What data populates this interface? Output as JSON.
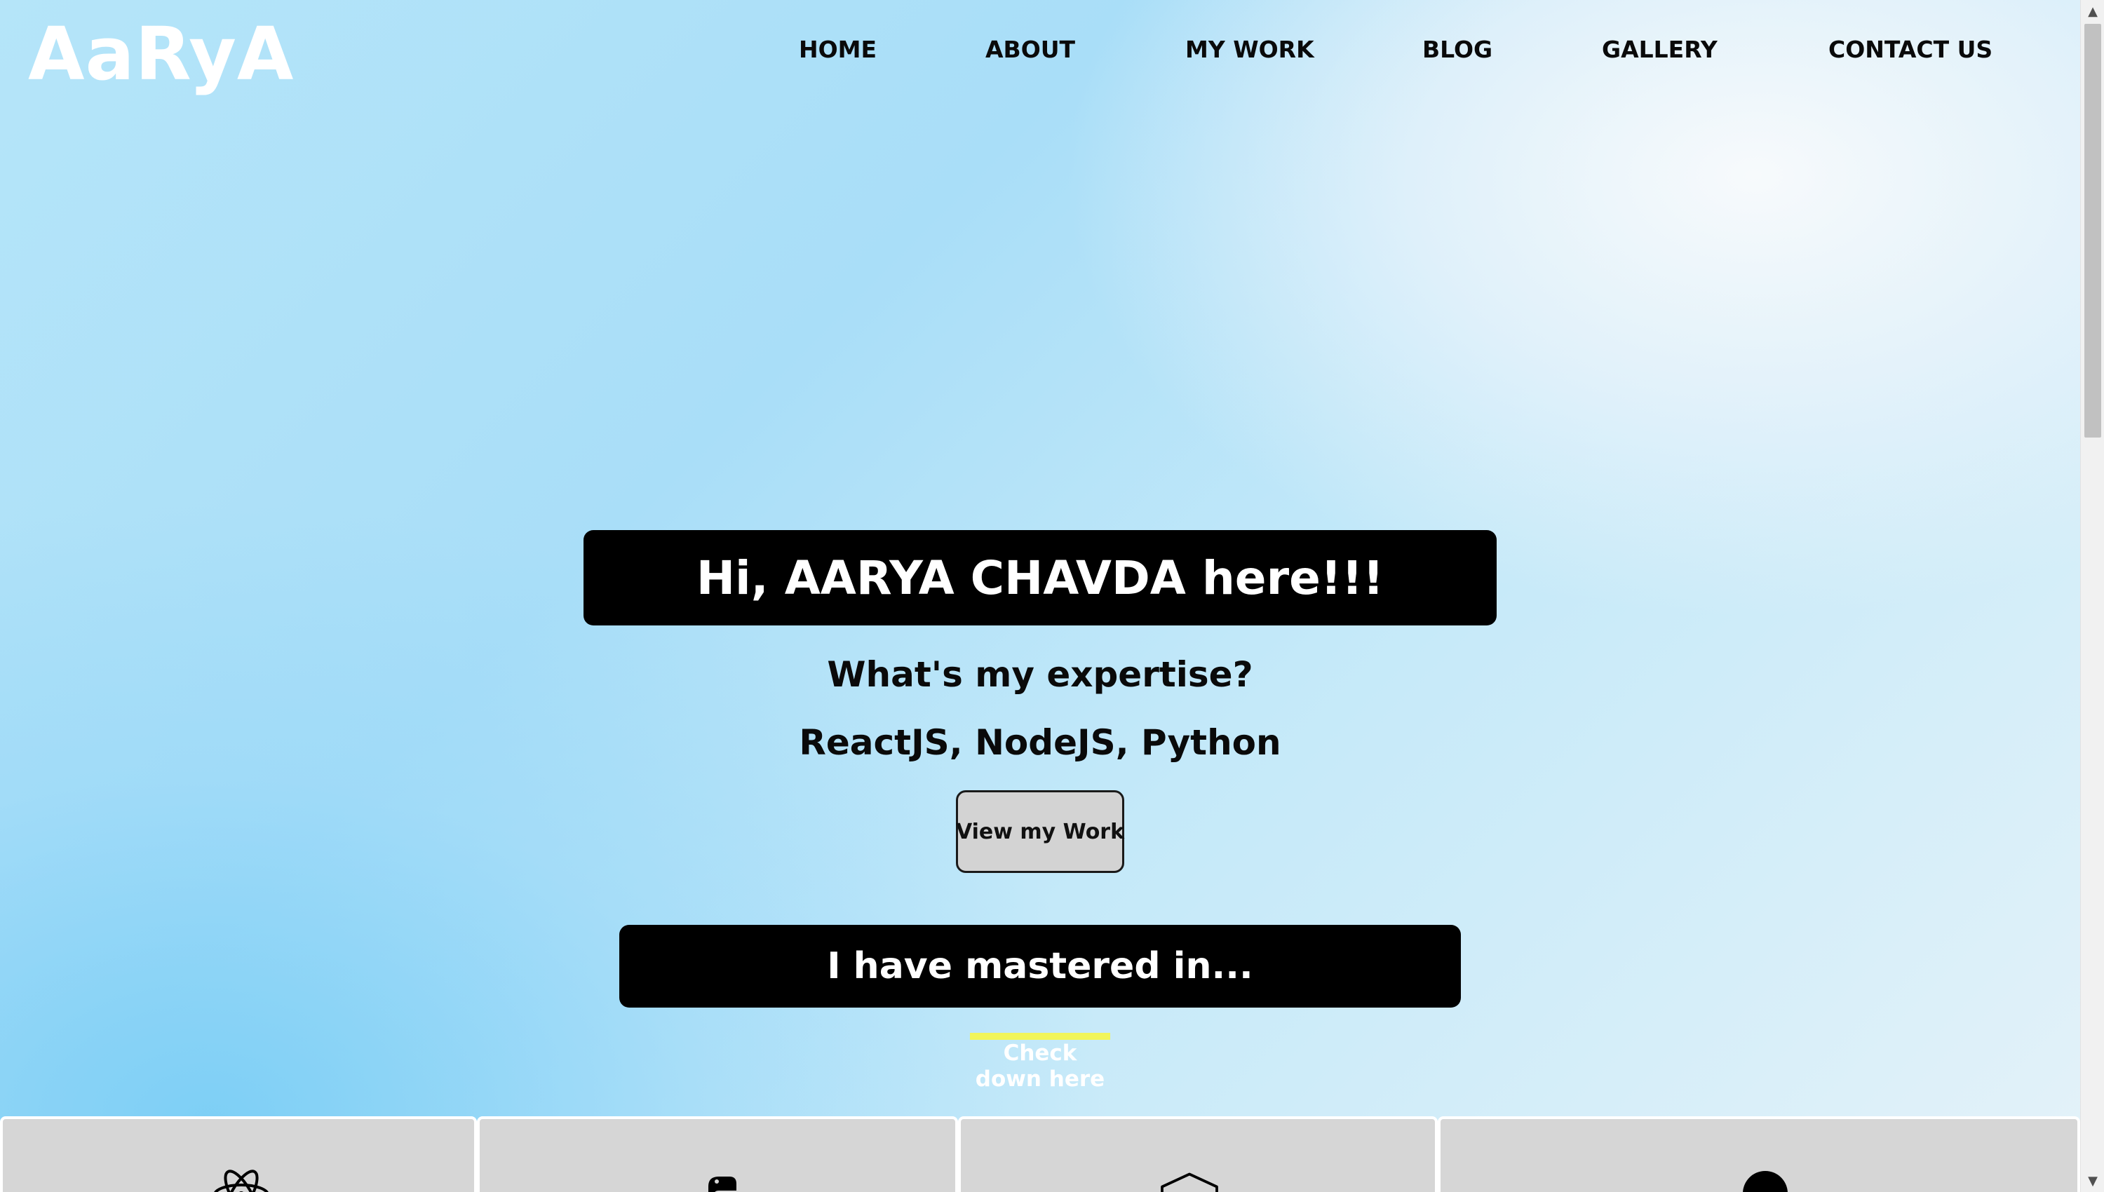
{
  "header": {
    "logo": "AaRyA",
    "nav": [
      "HOME",
      "ABOUT",
      "MY WORK",
      "BLOG",
      "GALLERY",
      "CONTACT US"
    ]
  },
  "hero": {
    "greeting": "Hi, AARYA CHAVDA here!!!",
    "expertise_question": "What's my expertise?",
    "expertise_answer": "ReactJS, NodeJS, Python",
    "view_work_label": "View my Work"
  },
  "skills": {
    "heading": "I have mastered in...",
    "check_line1": "Check",
    "check_line2": "down here",
    "accent_color": "#f1f55a",
    "cards": [
      {
        "icon": "react-icon"
      },
      {
        "icon": "python-icon"
      },
      {
        "icon": "nodejs-icon"
      },
      {
        "icon": "circle-icon"
      }
    ]
  },
  "colors": {
    "banner_bg": "#000000",
    "button_bg": "#d3d3d3",
    "card_bg": "#d6d6d6",
    "logo_color": "#ffffff"
  }
}
